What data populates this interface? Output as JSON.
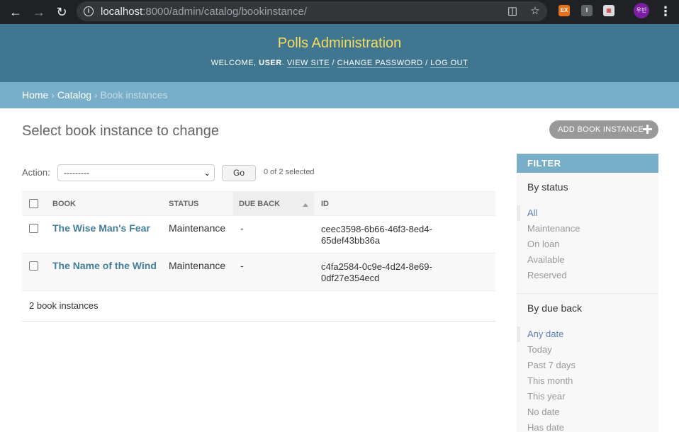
{
  "browser": {
    "url_host": "localhost",
    "url_path": ":8000/admin/catalog/bookinstance/",
    "avatar_text": "우빈"
  },
  "header": {
    "site_name": "Polls Administration",
    "welcome": "Welcome, ",
    "user": "user",
    "view_site": "View site",
    "change_password": "Change password",
    "log_out": "Log out"
  },
  "breadcrumbs": {
    "home": "Home",
    "catalog": "Catalog",
    "current": "Book instances",
    "separator": "›"
  },
  "main": {
    "title": "Select book instance to change",
    "add_button": "ADD BOOK INSTANCE",
    "action_label": "Action:",
    "action_selected": "---------",
    "go_button": "Go",
    "selected_count": "0 of 2 selected",
    "columns": [
      "BOOK",
      "STATUS",
      "DUE BACK",
      "ID"
    ],
    "rows": [
      {
        "book": "The Wise Man's Fear",
        "status": "Maintenance",
        "due_back": "-",
        "id_line1": "ceec3598-6b66-46f3-8ed4-",
        "id_line2": "65def43bb36a"
      },
      {
        "book": "The Name of the Wind",
        "status": "Maintenance",
        "due_back": "-",
        "id_line1": "c4fa2584-0c9e-4d24-8e69-",
        "id_line2": "0df27e354ecd"
      }
    ],
    "paginator": "2 book instances"
  },
  "filter": {
    "heading": "FILTER",
    "by_status": {
      "title": "By status",
      "options": [
        "All",
        "Maintenance",
        "On loan",
        "Available",
        "Reserved"
      ],
      "selected": "All"
    },
    "by_due_back": {
      "title": "By due back",
      "options": [
        "Any date",
        "Today",
        "Past 7 days",
        "This month",
        "This year",
        "No date",
        "Has date"
      ],
      "selected": "Any date"
    }
  },
  "colors": {
    "header_bg": "#417690",
    "site_name": "#f5dd5d",
    "breadcrumb_bg": "#79aec8",
    "link": "#447e9b"
  }
}
